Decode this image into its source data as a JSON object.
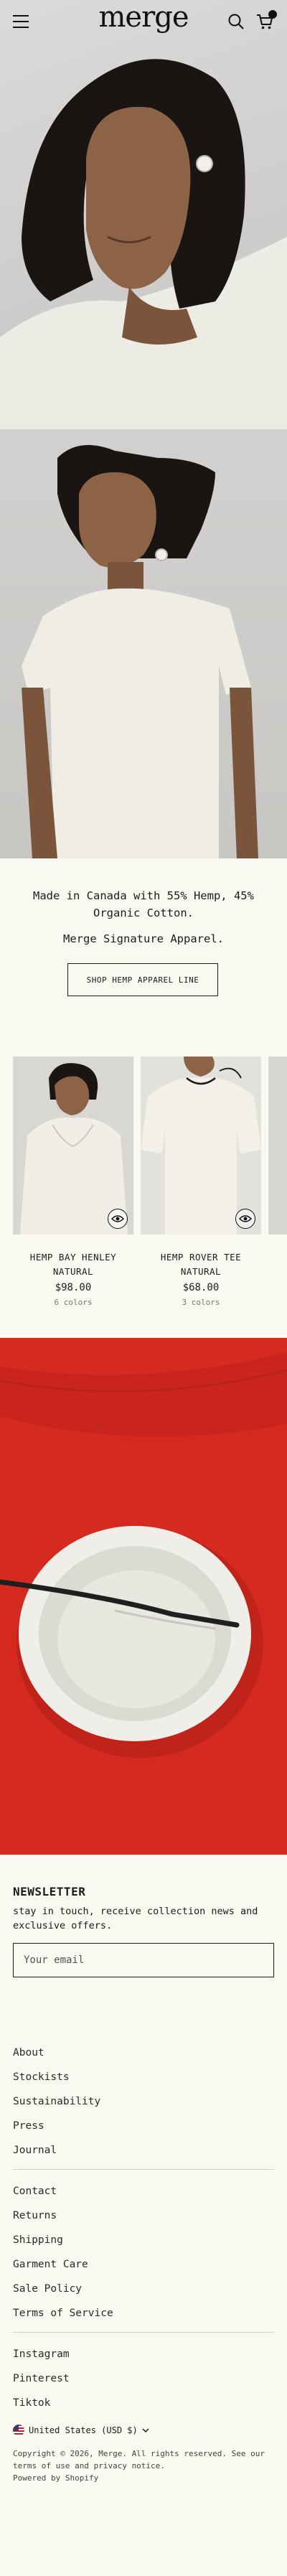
{
  "header": {
    "logo": "merge",
    "cart_count": "1"
  },
  "intro": {
    "line1": "Made in Canada with 55% Hemp, 45% Organic Cotton.",
    "line2": "Merge Signature Apparel.",
    "button": "SHOP HEMP APPAREL LINE"
  },
  "products": [
    {
      "name_line1": "HEMP BAY HENLEY",
      "name_line2": "NATURAL",
      "price": "$98.00",
      "colors": "6 colors"
    },
    {
      "name_line1": "HEMP ROVER TEE",
      "name_line2": "NATURAL",
      "price": "$68.00",
      "colors": "3 colors"
    }
  ],
  "newsletter": {
    "title": "NEWSLETTER",
    "text": "stay in touch, receive collection news and exclusive offers.",
    "placeholder": "Your email"
  },
  "footer": {
    "group1": [
      "About",
      "Stockists",
      "Sustainability",
      "Press",
      "Journal"
    ],
    "group2": [
      "Contact",
      "Returns",
      "Shipping",
      "Garment Care",
      "Sale Policy",
      "Terms of Service"
    ],
    "group3": [
      "Instagram",
      "Pinterest",
      "Tiktok"
    ],
    "currency": "United States (USD $)",
    "copyright": "Copyright © 2026, Merge. All rights reserved. See our terms of use and privacy notice.",
    "powered": "Powered by Shopify"
  },
  "icons": {
    "menu": "hamburger-icon",
    "search": "search-icon",
    "cart": "cart-icon",
    "quick_view": "eye-icon",
    "chevron": "chevron-down-icon",
    "flag": "us-flag-icon"
  },
  "colors": {
    "background": "#f9f8f1",
    "text": "#1c1c1c",
    "accent_red": "#d42a20"
  }
}
